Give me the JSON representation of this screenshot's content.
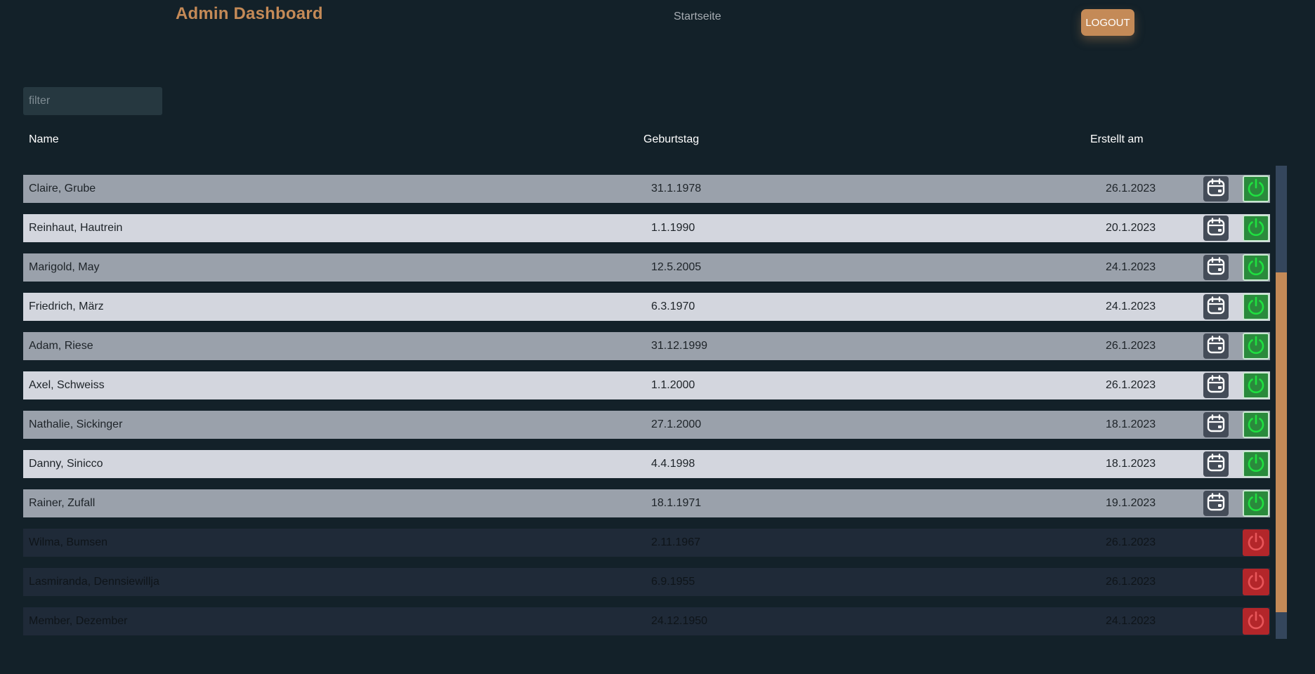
{
  "header": {
    "title": "Admin Dashboard",
    "nav_link": "Startseite",
    "logout_label": "LOGOUT"
  },
  "filter": {
    "placeholder": "filter",
    "value": ""
  },
  "table": {
    "columns": [
      "Name",
      "Geburtstag",
      "Erstellt am"
    ],
    "rows": [
      {
        "name": "Claire, Grube",
        "birthday": "31.1.1978",
        "created": "26.1.2023",
        "active": true
      },
      {
        "name": "Reinhaut, Hautrein",
        "birthday": "1.1.1990",
        "created": "20.1.2023",
        "active": true
      },
      {
        "name": "Marigold, May",
        "birthday": "12.5.2005",
        "created": "24.1.2023",
        "active": true
      },
      {
        "name": "Friedrich, März",
        "birthday": "6.3.1970",
        "created": "24.1.2023",
        "active": true
      },
      {
        "name": "Adam, Riese",
        "birthday": "31.12.1999",
        "created": "26.1.2023",
        "active": true
      },
      {
        "name": "Axel, Schweiss",
        "birthday": "1.1.2000",
        "created": "26.1.2023",
        "active": true
      },
      {
        "name": "Nathalie, Sickinger",
        "birthday": "27.1.2000",
        "created": "18.1.2023",
        "active": true
      },
      {
        "name": "Danny, Sinicco",
        "birthday": "4.4.1998",
        "created": "18.1.2023",
        "active": true
      },
      {
        "name": "Rainer, Zufall",
        "birthday": "18.1.1971",
        "created": "19.1.2023",
        "active": true
      },
      {
        "name": "Wilma, Bumsen",
        "birthday": "2.11.1967",
        "created": "26.1.2023",
        "active": false
      },
      {
        "name": "Lasmiranda, Dennsiewillja",
        "birthday": "6.9.1955",
        "created": "26.1.2023",
        "active": false
      },
      {
        "name": "Member, Dezember",
        "birthday": "24.12.1950",
        "created": "24.1.2023",
        "active": false
      }
    ]
  },
  "icons": {
    "calendar": "calendar-icon",
    "power": "power-icon"
  },
  "colors": {
    "background": "#132129",
    "accent": "#c48a57",
    "active_power": "#1fe040",
    "inactive_power": "#b3262a"
  }
}
